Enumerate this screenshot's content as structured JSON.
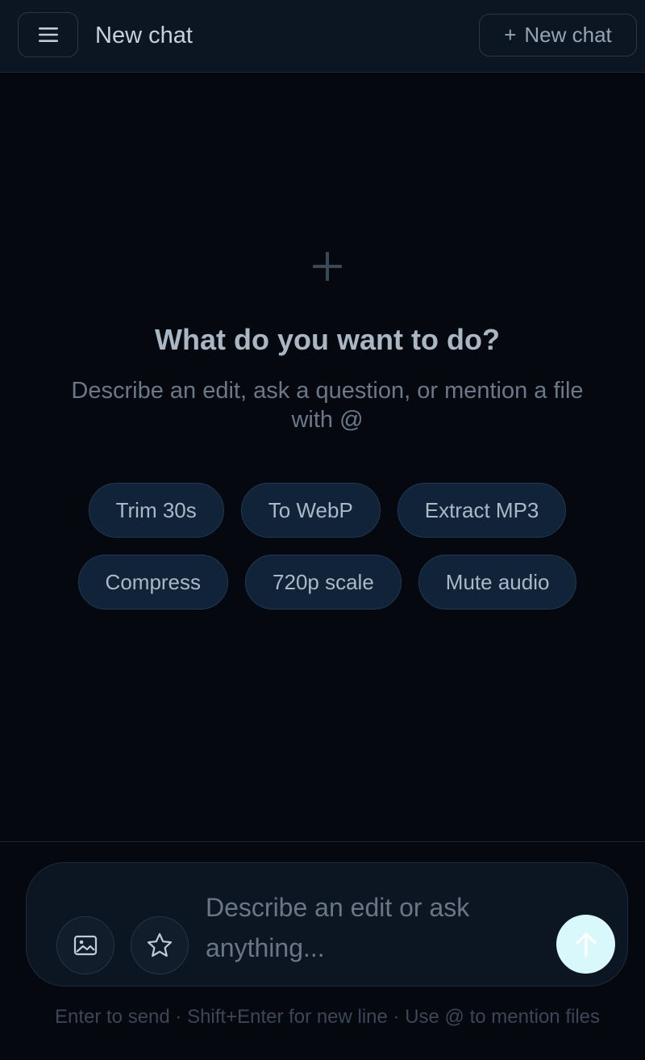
{
  "header": {
    "title": "New chat",
    "menu_icon": "hamburger-icon",
    "new_chat_label": "New chat",
    "new_chat_prefix": "+"
  },
  "hero": {
    "icon": "plus-icon",
    "title": "What do you want to do?",
    "subtitle": "Describe an edit, ask a question, or mention a file with @"
  },
  "suggestions": [
    {
      "label": "Trim 30s"
    },
    {
      "label": "To WebP"
    },
    {
      "label": "Extract MP3"
    },
    {
      "label": "Compress"
    },
    {
      "label": "720p scale"
    },
    {
      "label": "Mute audio"
    }
  ],
  "composer": {
    "placeholder": "Describe an edit or ask anything...",
    "image_icon": "image-icon",
    "star_icon": "star-icon",
    "send_icon": "arrow-up-icon"
  },
  "hint": "Enter to send · Shift+Enter for new line · Use @ to mention files",
  "colors": {
    "background": "#05080f",
    "header": "#0c1623",
    "chip": "#102338",
    "send_button": "#d8f8fc"
  }
}
